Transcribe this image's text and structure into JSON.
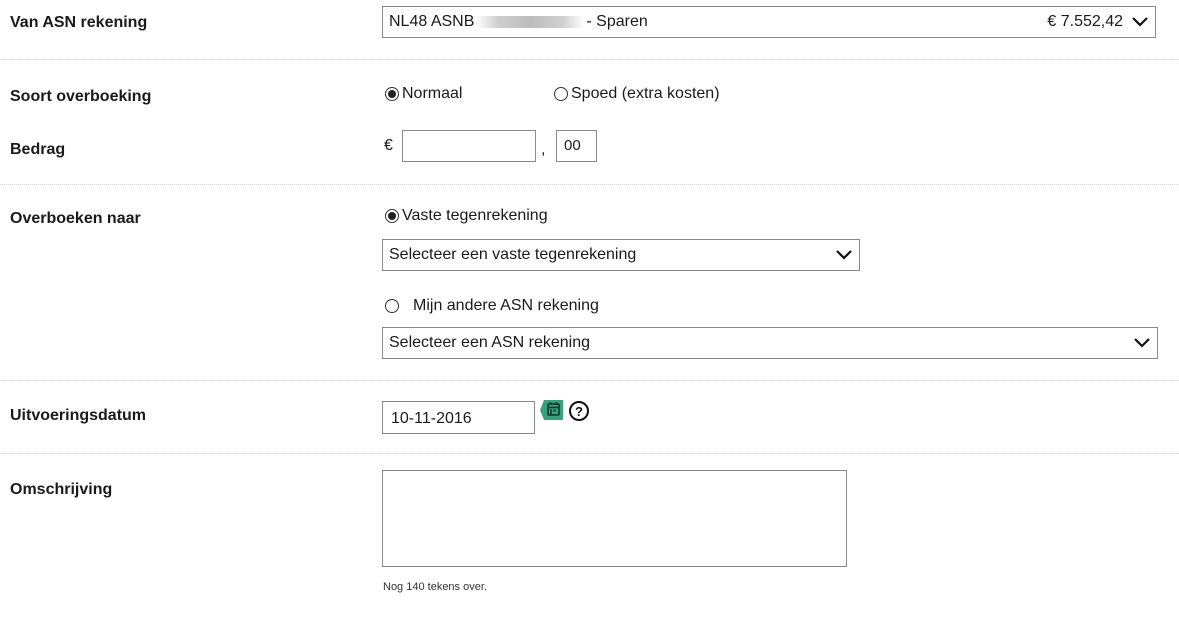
{
  "from_account": {
    "label": "Van ASN rekening",
    "iban_prefix": "NL48 ASNB",
    "account_suffix": "- Sparen",
    "balance": "€ 7.552,42"
  },
  "transfer_type": {
    "label": "Soort overboeking",
    "options": [
      {
        "label": "Normaal",
        "selected": true
      },
      {
        "label": "Spoed (extra kosten)",
        "selected": false
      }
    ]
  },
  "amount": {
    "label": "Bedrag",
    "currency_symbol": "€",
    "euros_value": "",
    "separator": ",",
    "cents_value": "00"
  },
  "transfer_to": {
    "label": "Overboeken naar",
    "fixed_option_label": "Vaste tegenrekening",
    "fixed_selected": true,
    "fixed_select_value": "Selecteer een vaste tegenrekening",
    "own_option_label": "Mijn andere ASN rekening",
    "own_selected": false,
    "own_select_value": "Selecteer een ASN rekening"
  },
  "execution_date": {
    "label": "Uitvoeringsdatum",
    "value": "10-11-2016",
    "help_glyph": "?"
  },
  "description": {
    "label": "Omschrijving",
    "value": "",
    "remaining_text": "Nog 140 tekens over."
  },
  "colors": {
    "calendar_accent": "#3aa17e",
    "border": "#8a8a8a"
  },
  "icons": [
    "chevron-down-icon",
    "calendar-icon",
    "help-icon",
    "scroll-up-icon",
    "scroll-down-icon"
  ]
}
